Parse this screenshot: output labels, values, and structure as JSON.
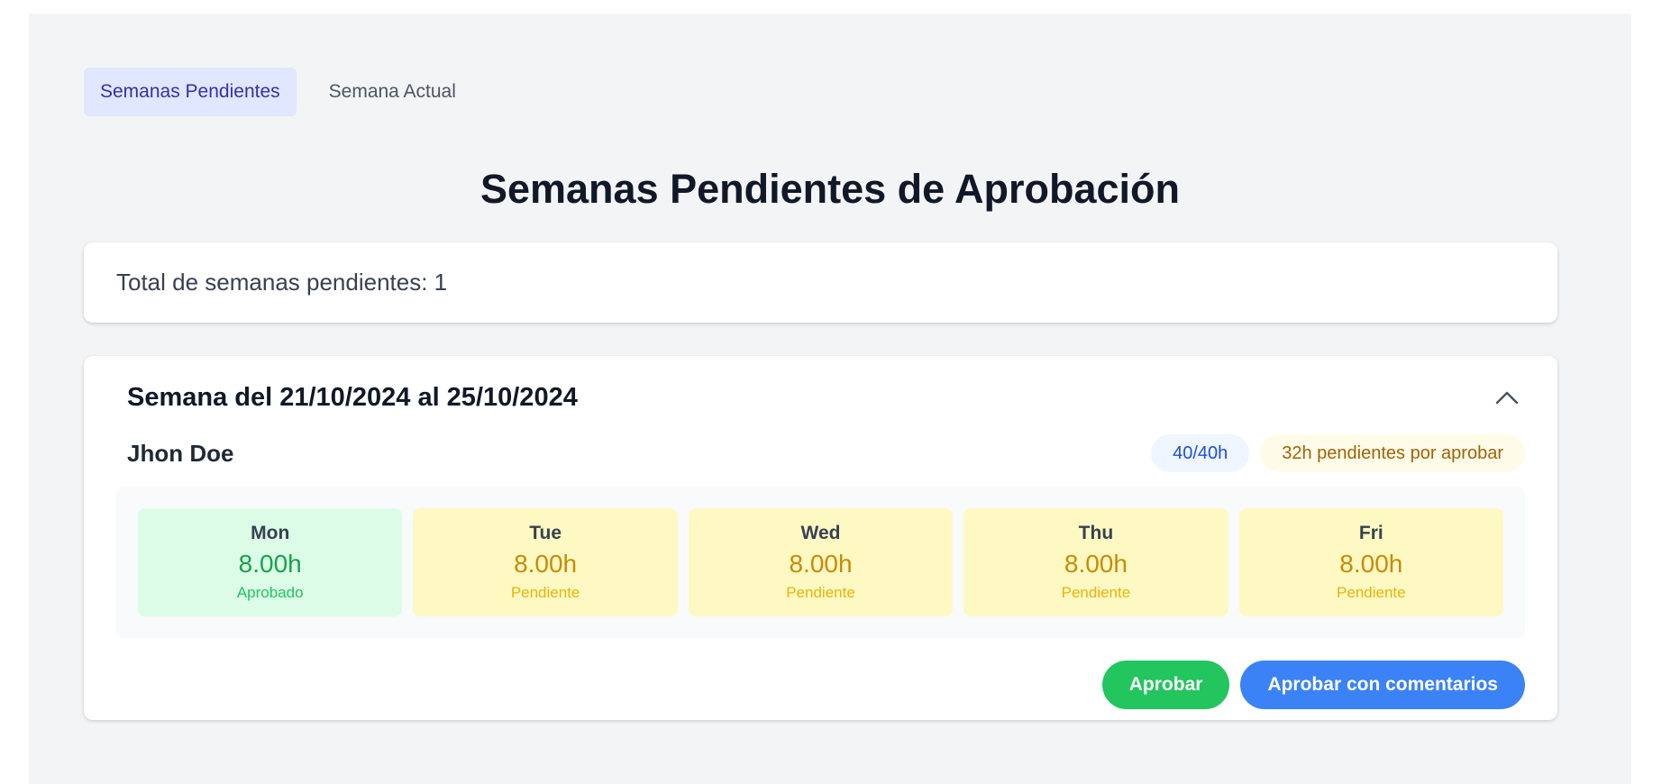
{
  "tabs": [
    {
      "label": "Semanas Pendientes",
      "active": true
    },
    {
      "label": "Semana Actual",
      "active": false
    }
  ],
  "page_title": "Semanas Pendientes de Aprobación",
  "summary": {
    "text": "Total de semanas pendientes: 1"
  },
  "week": {
    "title": "Semana del 21/10/2024 al 25/10/2024",
    "collapse_icon": "chevron-up-icon",
    "employee": "Jhon Doe",
    "hours_badge": "40/40h",
    "pending_badge": "32h pendientes por aprobar",
    "days": [
      {
        "name": "Mon",
        "hours": "8.00h",
        "status": "Aprobado",
        "state": "approved"
      },
      {
        "name": "Tue",
        "hours": "8.00h",
        "status": "Pendiente",
        "state": "pending"
      },
      {
        "name": "Wed",
        "hours": "8.00h",
        "status": "Pendiente",
        "state": "pending"
      },
      {
        "name": "Thu",
        "hours": "8.00h",
        "status": "Pendiente",
        "state": "pending"
      },
      {
        "name": "Fri",
        "hours": "8.00h",
        "status": "Pendiente",
        "state": "pending"
      }
    ],
    "actions": {
      "approve_label": "Aprobar",
      "approve_comments_label": "Aprobar con comentarios"
    }
  },
  "colors": {
    "approve_button": "#22c55e",
    "approve_comments_button": "#3b82f6",
    "active_tab_bg": "#e0e7ff",
    "approved_day_bg": "#dcfce7",
    "pending_day_bg": "#fef9c3"
  }
}
